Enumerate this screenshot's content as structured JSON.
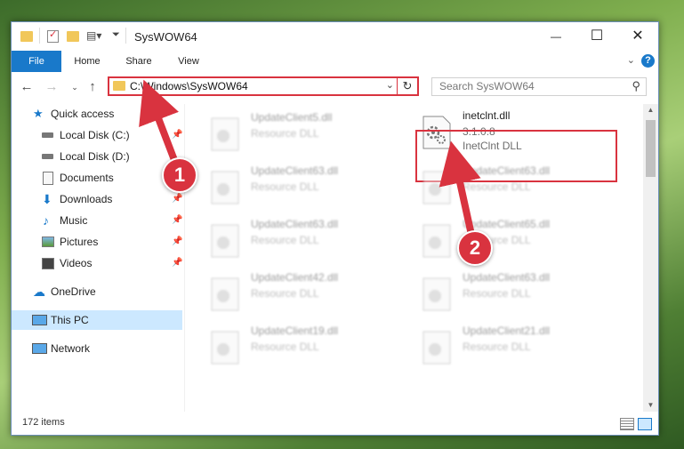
{
  "window": {
    "title": "SysWOW64",
    "controls": {
      "minimize": "—",
      "maximize": "☐",
      "close": "✕"
    }
  },
  "ribbon": {
    "tabs": [
      "File",
      "Home",
      "Share",
      "View"
    ],
    "help_label": "?"
  },
  "navigation": {
    "address": "C:\\Windows\\SysWOW64",
    "search_placeholder": "Search SysWOW64"
  },
  "sidebar": {
    "items": [
      {
        "label": "Quick access",
        "icon": "star-icon",
        "pinned": false
      },
      {
        "label": "Local Disk (C:)",
        "icon": "drive-icon",
        "pinned": true
      },
      {
        "label": "Local Disk (D:)",
        "icon": "drive-icon",
        "pinned": false
      },
      {
        "label": "Documents",
        "icon": "documents-icon",
        "pinned": true
      },
      {
        "label": "Downloads",
        "icon": "download-icon",
        "pinned": true
      },
      {
        "label": "Music",
        "icon": "music-icon",
        "pinned": true
      },
      {
        "label": "Pictures",
        "icon": "pictures-icon",
        "pinned": true
      },
      {
        "label": "Videos",
        "icon": "videos-icon",
        "pinned": true
      },
      {
        "label": "OneDrive",
        "icon": "cloud-icon",
        "pinned": false
      },
      {
        "label": "This PC",
        "icon": "computer-icon",
        "pinned": false,
        "selected": true
      },
      {
        "label": "Network",
        "icon": "network-icon",
        "pinned": false
      }
    ]
  },
  "files": [
    {
      "name": "UpdateClient5.dll",
      "type": "Resource DLL"
    },
    {
      "name": "inetclnt.dll",
      "version": "3.1.0.8",
      "description": "InetClnt DLL",
      "highlighted": true
    },
    {
      "name": "UpdateClient63.dll",
      "type": "Resource DLL"
    },
    {
      "name": "UpdateClient63.dll",
      "type": "Resource DLL"
    },
    {
      "name": "UpdateClient63.dll",
      "type": "Resource DLL"
    },
    {
      "name": "UpdateClient65.dll",
      "type": "Resource DLL"
    },
    {
      "name": "UpdateClient42.dll",
      "type": "Resource DLL"
    },
    {
      "name": "UpdateClient63.dll",
      "type": "Resource DLL"
    },
    {
      "name": "UpdateClient19.dll",
      "type": "Resource DLL"
    },
    {
      "name": "UpdateClient21.dll",
      "type": "Resource DLL"
    }
  ],
  "status": {
    "item_count": "172 items"
  },
  "annotations": {
    "step1": "1",
    "step2": "2"
  },
  "colors": {
    "accent": "#1979ca",
    "highlight": "#d9333f",
    "selected": "#cce8ff"
  }
}
